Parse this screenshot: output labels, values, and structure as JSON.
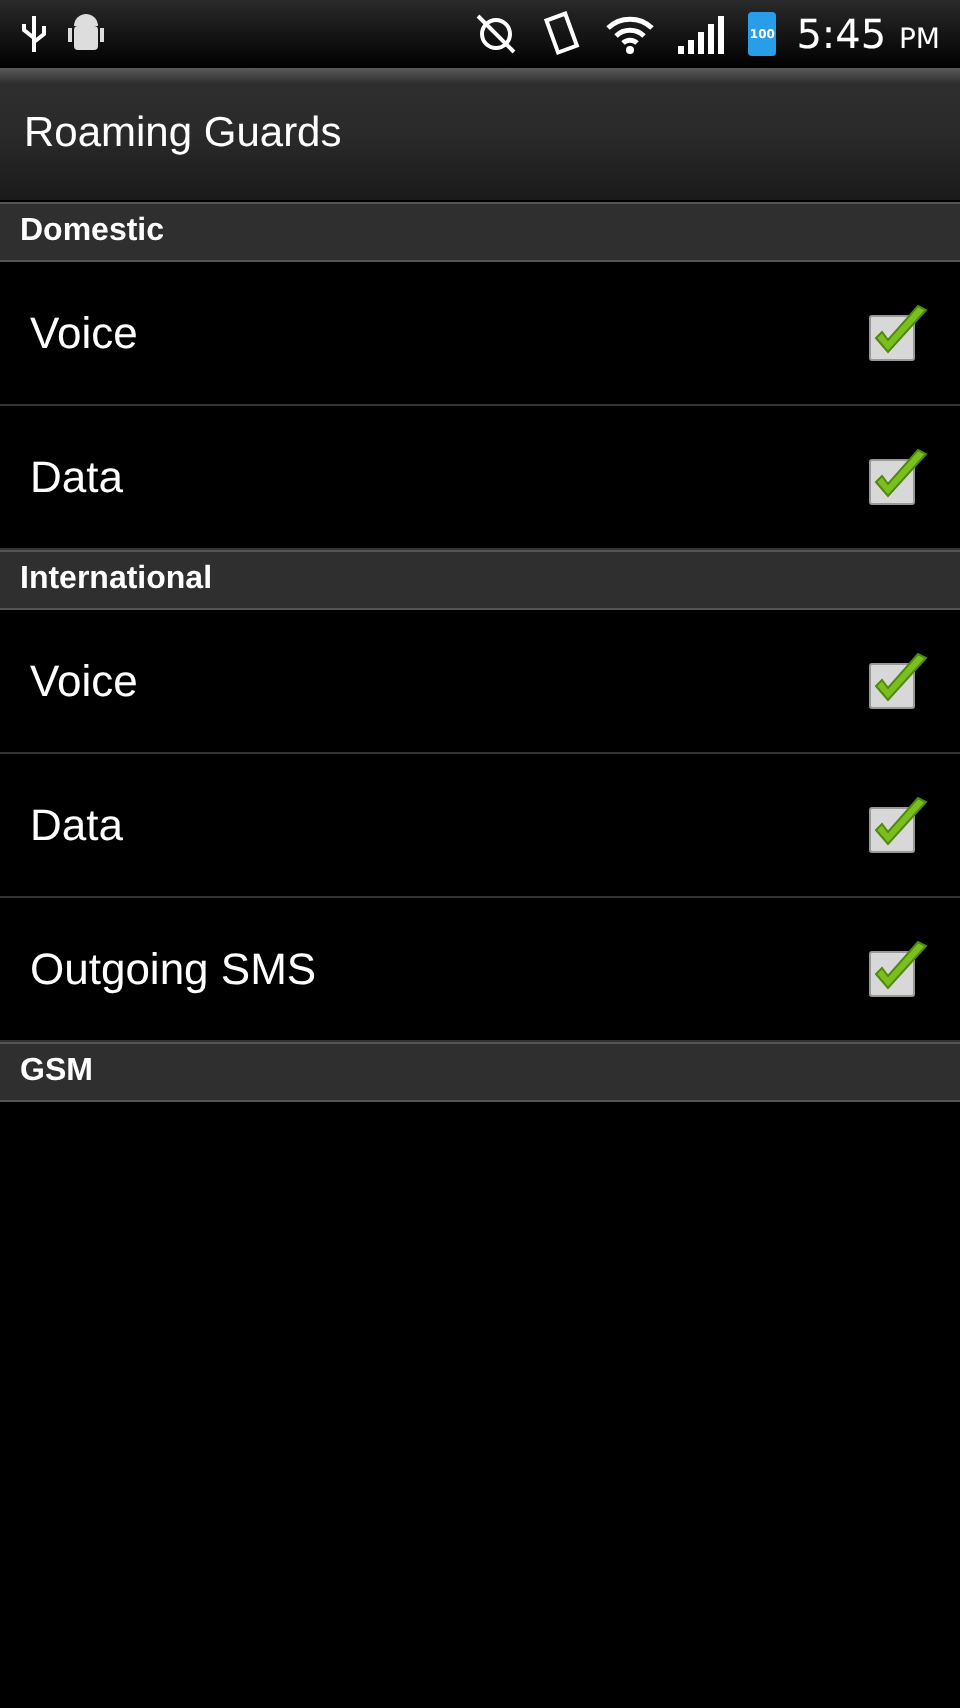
{
  "status_bar": {
    "battery": "100",
    "time": "5:45",
    "ampm": "PM"
  },
  "title": "Roaming Guards",
  "sections": [
    {
      "header": "Domestic",
      "items": [
        {
          "label": "Voice",
          "checked": true
        },
        {
          "label": "Data",
          "checked": true
        }
      ]
    },
    {
      "header": "International",
      "items": [
        {
          "label": "Voice",
          "checked": true
        },
        {
          "label": "Data",
          "checked": true
        },
        {
          "label": "Outgoing SMS",
          "checked": true
        }
      ]
    },
    {
      "header": "GSM"
    }
  ]
}
